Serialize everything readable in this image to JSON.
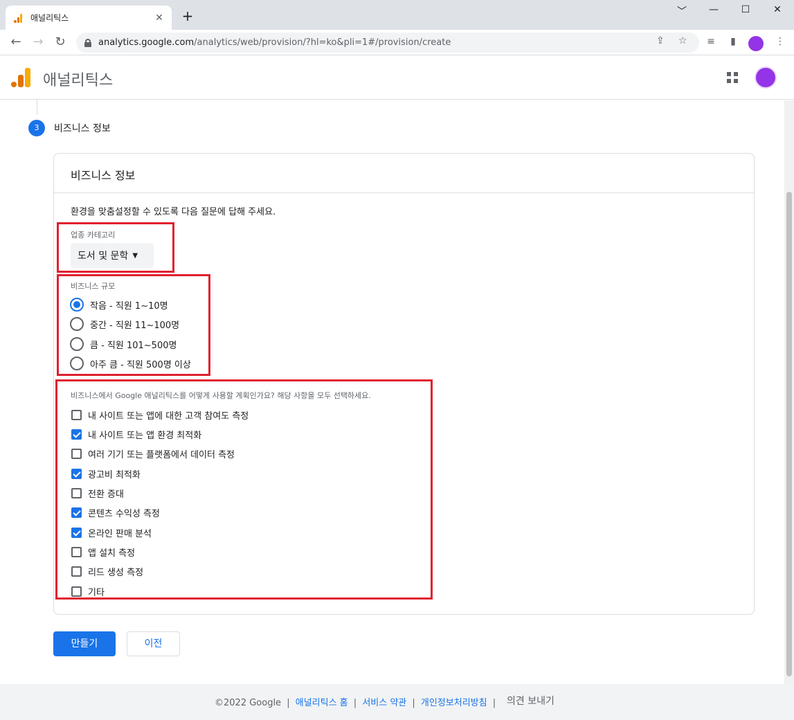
{
  "browser": {
    "tab_title": "애널리틱스",
    "close_glyph": "✕",
    "newtab_glyph": "+",
    "url_host": "analytics.google.com",
    "url_path": "/analytics/web/provision/?hl=ko&pli=1#/provision/create",
    "window_controls": [
      "﹀",
      "—",
      "☐",
      "✕"
    ],
    "nav": {
      "back": "←",
      "forward": "→",
      "reload": "↻"
    },
    "icons": [
      "share-icon",
      "star-icon",
      "reading-list-icon",
      "side-panel-icon",
      "profile-icon",
      "menu-icon"
    ],
    "icon_glyphs": {
      "share": "⇪",
      "star": "☆",
      "reading_list": "≡",
      "side_panel": "▮",
      "menu": "⋮"
    }
  },
  "app": {
    "title": "애널리틱스",
    "logo_colors": [
      "#f9ab00",
      "#e37400"
    ],
    "accent": "#1a73e8",
    "highlight_color": "#e0202e"
  },
  "step": {
    "number": "3",
    "title": "비즈니스 정보"
  },
  "card": {
    "title": "비즈니스 정보",
    "intro": "환경을 맞춤설정할 수 있도록 다음 질문에 답해 주세요."
  },
  "industry": {
    "label": "업종 카테고리",
    "selected": "도서 및 문학",
    "caret": "▼"
  },
  "size": {
    "label": "비즈니스 규모",
    "options": [
      {
        "label": "작음 - 직원 1~10명",
        "selected": true
      },
      {
        "label": "중간 - 직원 11~100명",
        "selected": false
      },
      {
        "label": "큼 - 직원 101~500명",
        "selected": false
      },
      {
        "label": "아주 큼 - 직원 500명 이상",
        "selected": false
      }
    ]
  },
  "usage": {
    "label": "비즈니스에서 Google 애널리틱스를 어떻게 사용할 계획인가요? 해당 사항을 모두 선택하세요.",
    "options": [
      {
        "label": "내 사이트 또는 앱에 대한 고객 참여도 측정",
        "checked": false
      },
      {
        "label": "내 사이트 또는 앱 환경 최적화",
        "checked": true
      },
      {
        "label": "여러 기기 또는 플랫폼에서 데이터 측정",
        "checked": false
      },
      {
        "label": "광고비 최적화",
        "checked": true
      },
      {
        "label": "전환 증대",
        "checked": false
      },
      {
        "label": "콘텐츠 수익성 측정",
        "checked": true
      },
      {
        "label": "온라인 판매 분석",
        "checked": true
      },
      {
        "label": "앱 설치 측정",
        "checked": false
      },
      {
        "label": "리드 생성 측정",
        "checked": false
      },
      {
        "label": "기타",
        "checked": false
      }
    ]
  },
  "buttons": {
    "create": "만들기",
    "back": "이전"
  },
  "footer": {
    "copyright": "©2022 Google",
    "sep": "|",
    "links": [
      "애널리틱스 홈",
      "서비스 약관",
      "개인정보처리방침"
    ],
    "feedback": "의견 보내기"
  }
}
